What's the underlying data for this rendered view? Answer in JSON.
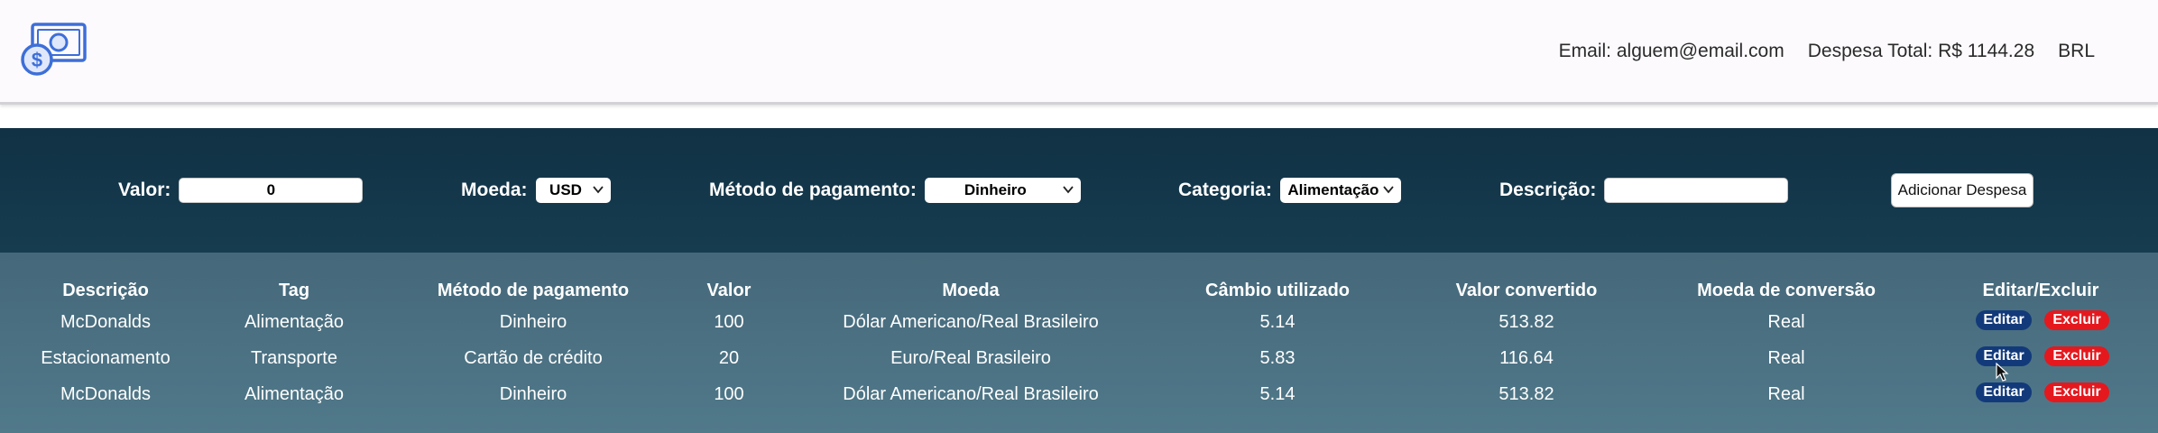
{
  "header": {
    "email": "Email: alguem@email.com",
    "total": "Despesa Total: R$ 1144.28",
    "currency": "BRL"
  },
  "form": {
    "valor_label": "Valor:",
    "valor_value": "0",
    "moeda_label": "Moeda:",
    "moeda_value": "USD",
    "metodo_label": "Método de pagamento:",
    "metodo_value": "Dinheiro",
    "categoria_label": "Categoria:",
    "categoria_value": "Alimentação",
    "descricao_label": "Descrição:",
    "descricao_value": "",
    "add_label": "Adicionar Despesa"
  },
  "table": {
    "headers": [
      "Descrição",
      "Tag",
      "Método de pagamento",
      "Valor",
      "Moeda",
      "Câmbio utilizado",
      "Valor convertido",
      "Moeda de conversão",
      "Editar/Excluir"
    ],
    "rows": [
      [
        "McDonalds",
        "Alimentação",
        "Dinheiro",
        "100",
        "Dólar Americano/Real Brasileiro",
        "5.14",
        "513.82",
        "Real"
      ],
      [
        "Estacionamento",
        "Transporte",
        "Cartão de crédito",
        "20",
        "Euro/Real Brasileiro",
        "5.83",
        "116.64",
        "Real"
      ],
      [
        "McDonalds",
        "Alimentação",
        "Dinheiro",
        "100",
        "Dólar Americano/Real Brasileiro",
        "5.14",
        "513.82",
        "Real"
      ]
    ],
    "edit_label": "Editar",
    "delete_label": "Excluir"
  },
  "colors": {
    "form_bg": "#133446",
    "table_bg": "#4b7183",
    "edit_button": "#123a7a",
    "delete_button": "#e5181e"
  },
  "icons": {
    "logo": "money-bill-icon",
    "select": "chevron-down-icon",
    "cursor": "mouse-pointer-icon"
  }
}
